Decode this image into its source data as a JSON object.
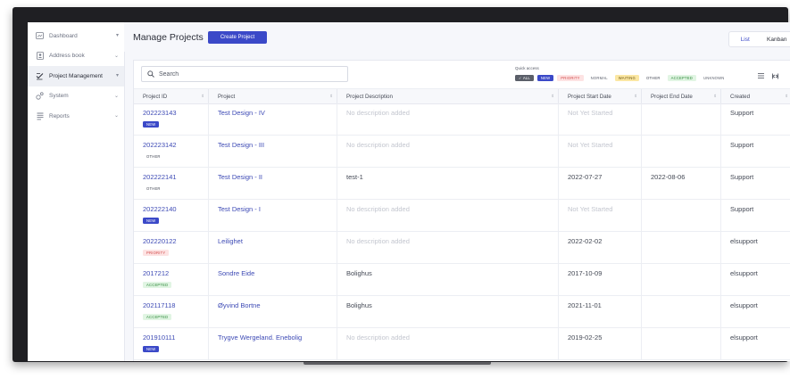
{
  "colors": {
    "accent": "#3b49c8",
    "link": "#3d4ab5",
    "status": {
      "NEW": {
        "bg": "#3b49c8",
        "fg": "#ffffff"
      },
      "OTHER": {
        "bg": "#ffffff",
        "fg": "#444955"
      },
      "PRIORITY": {
        "bg": "#fde3e3",
        "fg": "#d24b4b"
      },
      "ACCEPTED": {
        "bg": "#e1f5e3",
        "fg": "#2f8a3b"
      },
      "NORMAL": {
        "bg": "#ffffff",
        "fg": "#5a5f6b"
      },
      "WAITING": {
        "bg": "#fbe7a3",
        "fg": "#6b5410"
      },
      "UNKNOWN": {
        "bg": "#ffffff",
        "fg": "#5a5f6b"
      },
      "ALL": {
        "bg": "#5b5f69",
        "fg": "#ffffff"
      }
    }
  },
  "sidebar": {
    "items": [
      {
        "label": "Dashboard",
        "icon": "dashboard-icon",
        "active": false
      },
      {
        "label": "Address book",
        "icon": "address-book-icon",
        "active": false
      },
      {
        "label": "Project Management",
        "icon": "project-management-icon",
        "active": true
      },
      {
        "label": "System",
        "icon": "system-icon",
        "active": false
      },
      {
        "label": "Reports",
        "icon": "reports-icon",
        "active": false
      }
    ]
  },
  "header": {
    "title": "Manage Projects",
    "create_label": "Create Project",
    "views": [
      "List",
      "Kanban"
    ],
    "selected_view": "List"
  },
  "search": {
    "placeholder": "Search",
    "value": ""
  },
  "quick_access": {
    "label": "Quick access",
    "chips": [
      {
        "label": "✓ ALL",
        "key": "ALL"
      },
      {
        "label": "NEW",
        "key": "NEW"
      },
      {
        "label": "PRIORITY",
        "key": "PRIORITY"
      },
      {
        "label": "NORMAL",
        "key": "NORMAL"
      },
      {
        "label": "WAITING",
        "key": "WAITING"
      },
      {
        "label": "OTHER",
        "key": "OTHER"
      },
      {
        "label": "ACCEPTED",
        "key": "ACCEPTED"
      },
      {
        "label": "UNKNOWN",
        "key": "UNKNOWN"
      }
    ]
  },
  "tools": {
    "list_icon": "list-lines-icon",
    "columns_icon": "columns-toggle-icon"
  },
  "table": {
    "columns": [
      "Project ID",
      "Project",
      "Project Description",
      "Project Start Date",
      "Project End Date",
      "Created"
    ],
    "rows": [
      {
        "id": "202223143",
        "status": "NEW",
        "project": "Test Design - IV",
        "description": "No description added",
        "description_empty": true,
        "start": "Not Yet Started",
        "start_empty": true,
        "end": "",
        "created": "Support"
      },
      {
        "id": "202223142",
        "status": "OTHER",
        "project": "Test Design - III",
        "description": "No description added",
        "description_empty": true,
        "start": "Not Yet Started",
        "start_empty": true,
        "end": "",
        "created": "Support"
      },
      {
        "id": "202222141",
        "status": "OTHER",
        "project": "Test Design - II",
        "description": "test-1",
        "description_empty": false,
        "start": "2022-07-27",
        "start_empty": false,
        "end": "2022-08-06",
        "created": "Support"
      },
      {
        "id": "202222140",
        "status": "NEW",
        "project": "Test Design - I",
        "description": "No description added",
        "description_empty": true,
        "start": "Not Yet Started",
        "start_empty": true,
        "end": "",
        "created": "Support"
      },
      {
        "id": "202220122",
        "status": "PRIORITY",
        "project": "Leilighet",
        "description": "No description added",
        "description_empty": true,
        "start": "2022-02-02",
        "start_empty": false,
        "end": "",
        "created": "elsupport"
      },
      {
        "id": "2017212",
        "status": "ACCEPTED",
        "project": "Sondre Eide",
        "description": "Bolighus",
        "description_empty": false,
        "start": "2017-10-09",
        "start_empty": false,
        "end": "",
        "created": "elsupport"
      },
      {
        "id": "202117118",
        "status": "ACCEPTED",
        "project": "Øyvind Bortne",
        "description": "Bolighus",
        "description_empty": false,
        "start": "2021-11-01",
        "start_empty": false,
        "end": "",
        "created": "elsupport"
      },
      {
        "id": "201910111",
        "status": "NEW",
        "project": "Trygve Wergeland. Enebolig",
        "description": "No description added",
        "description_empty": true,
        "start": "2019-02-25",
        "start_empty": false,
        "end": "",
        "created": "elsupport"
      }
    ]
  }
}
